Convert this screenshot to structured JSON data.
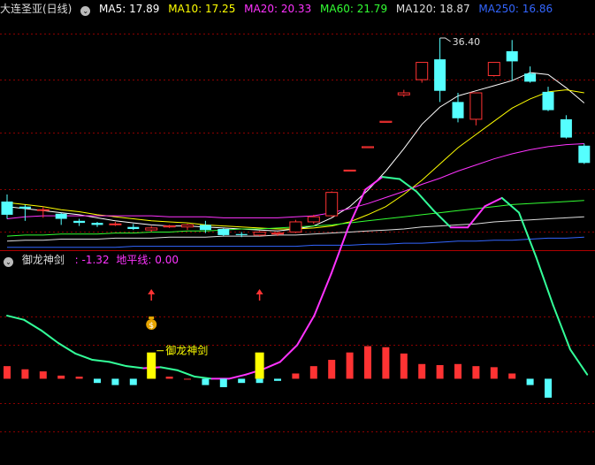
{
  "header": {
    "symbol": "大连圣亚(日线)",
    "ma": [
      {
        "label": "MA5: 17.89",
        "color": "#ffffff"
      },
      {
        "label": "MA10: 17.25",
        "color": "#ffff00"
      },
      {
        "label": "MA20: 20.33",
        "color": "#ff33ff"
      },
      {
        "label": "MA60: 21.79",
        "color": "#33ff33"
      },
      {
        "label": "MA120: 18.87",
        "color": "#dddddd"
      },
      {
        "label": "MA250: 16.86",
        "color": "#3366ff"
      }
    ],
    "icon": "chevron-down-icon"
  },
  "indicator_header": {
    "name": "御龙神剑",
    "value_label": ": -1.32",
    "baseline_label": "地平线: 0.00",
    "icon": "chevron-down-icon"
  },
  "annotations": {
    "max_price": "36.40",
    "signal_label": "御龙神剑",
    "money_icon": "money-bag-icon",
    "arrow_icon": "up-arrow-icon"
  },
  "colors": {
    "up": "#ff3333",
    "down": "#55ffff",
    "signal_bar": "#ffff00",
    "osc_down": "#33ff99",
    "osc_up": "#ff33ff",
    "grid": "#8b0000"
  },
  "chart_data": [
    {
      "type": "candlestick",
      "title": "大连圣亚(日线)",
      "candles": [
        {
          "o": 20.3,
          "h": 21.0,
          "l": 18.6,
          "c": 19.0
        },
        {
          "o": 19.8,
          "h": 20.0,
          "l": 18.4,
          "c": 19.6
        },
        {
          "o": 19.5,
          "h": 19.8,
          "l": 18.7,
          "c": 19.5
        },
        {
          "o": 19.1,
          "h": 19.2,
          "l": 18.0,
          "c": 18.6
        },
        {
          "o": 18.4,
          "h": 18.6,
          "l": 17.9,
          "c": 18.2
        },
        {
          "o": 18.2,
          "h": 18.3,
          "l": 17.8,
          "c": 18.0
        },
        {
          "o": 18.1,
          "h": 18.3,
          "l": 17.9,
          "c": 18.1
        },
        {
          "o": 17.8,
          "h": 18.1,
          "l": 17.5,
          "c": 17.6
        },
        {
          "o": 17.5,
          "h": 17.9,
          "l": 17.3,
          "c": 17.7
        },
        {
          "o": 17.8,
          "h": 18.0,
          "l": 17.7,
          "c": 17.9
        },
        {
          "o": 17.8,
          "h": 18.1,
          "l": 17.5,
          "c": 18.0
        },
        {
          "o": 18.0,
          "h": 18.4,
          "l": 17.2,
          "c": 17.5
        },
        {
          "o": 17.6,
          "h": 17.7,
          "l": 16.9,
          "c": 17.0
        },
        {
          "o": 17.1,
          "h": 17.3,
          "l": 16.8,
          "c": 17.0
        },
        {
          "o": 17.0,
          "h": 17.4,
          "l": 16.9,
          "c": 17.3
        },
        {
          "o": 17.1,
          "h": 17.3,
          "l": 16.9,
          "c": 17.2
        },
        {
          "o": 17.3,
          "h": 18.5,
          "l": 17.2,
          "c": 18.3
        },
        {
          "o": 18.3,
          "h": 19.0,
          "l": 18.1,
          "c": 18.8
        },
        {
          "o": 18.9,
          "h": 21.3,
          "l": 18.8,
          "c": 21.2
        },
        {
          "o": 23.3,
          "h": 23.4,
          "l": 23.3,
          "c": 23.4
        },
        {
          "o": 25.6,
          "h": 25.7,
          "l": 25.6,
          "c": 25.7
        },
        {
          "o": 28.1,
          "h": 28.2,
          "l": 28.1,
          "c": 28.2
        },
        {
          "o": 30.8,
          "h": 31.3,
          "l": 30.6,
          "c": 31.0
        },
        {
          "o": 32.3,
          "h": 34.0,
          "l": 32.0,
          "c": 34.0
        },
        {
          "o": 34.3,
          "h": 36.4,
          "l": 30.1,
          "c": 31.2
        },
        {
          "o": 30.1,
          "h": 31.0,
          "l": 28.1,
          "c": 28.5
        },
        {
          "o": 28.4,
          "h": 31.0,
          "l": 27.8,
          "c": 31.0
        },
        {
          "o": 32.7,
          "h": 34.0,
          "l": 32.6,
          "c": 34.0
        },
        {
          "o": 35.1,
          "h": 36.2,
          "l": 32.2,
          "c": 34.1
        },
        {
          "o": 32.9,
          "h": 33.6,
          "l": 32.0,
          "c": 32.1
        },
        {
          "o": 31.1,
          "h": 31.6,
          "l": 29.2,
          "c": 29.3
        },
        {
          "o": 28.4,
          "h": 28.8,
          "l": 26.5,
          "c": 26.6
        },
        {
          "o": 25.8,
          "h": 26.0,
          "l": 24.0,
          "c": 24.1
        }
      ],
      "ma_lines": {
        "MA5": [
          19.8,
          19.6,
          19.4,
          19.2,
          19.0,
          18.7,
          18.4,
          18.2,
          18.0,
          17.9,
          17.9,
          17.8,
          17.7,
          17.6,
          17.5,
          17.4,
          17.6,
          17.9,
          18.7,
          19.8,
          21.4,
          23.3,
          25.5,
          27.9,
          29.6,
          30.7,
          31.2,
          31.7,
          32.2,
          33.0,
          32.8,
          31.5,
          30.0
        ],
        "MA10": [
          20.2,
          20.0,
          19.8,
          19.5,
          19.3,
          19.0,
          18.8,
          18.6,
          18.4,
          18.3,
          18.2,
          18.0,
          17.9,
          17.8,
          17.7,
          17.6,
          17.6,
          17.7,
          17.9,
          18.3,
          19.0,
          19.8,
          21.0,
          22.4,
          24.0,
          25.6,
          26.9,
          28.2,
          29.5,
          30.4,
          31.1,
          31.3,
          31.0
        ],
        "MA20": [
          18.6,
          18.8,
          18.9,
          18.9,
          18.9,
          18.9,
          18.9,
          18.9,
          18.9,
          18.8,
          18.8,
          18.8,
          18.7,
          18.7,
          18.7,
          18.7,
          18.8,
          18.9,
          19.2,
          19.6,
          20.1,
          20.7,
          21.3,
          22.0,
          22.6,
          23.3,
          23.9,
          24.5,
          25.0,
          25.4,
          25.7,
          25.9,
          26.0
        ],
        "MA60": [
          16.9,
          17.0,
          17.0,
          17.1,
          17.1,
          17.1,
          17.2,
          17.2,
          17.3,
          17.3,
          17.4,
          17.4,
          17.5,
          17.6,
          17.6,
          17.7,
          17.8,
          17.9,
          18.0,
          18.2,
          18.4,
          18.6,
          18.8,
          19.0,
          19.2,
          19.4,
          19.6,
          19.8,
          20.0,
          20.1,
          20.2,
          20.3,
          20.4
        ],
        "MA120": [
          16.4,
          16.5,
          16.5,
          16.6,
          16.6,
          16.6,
          16.7,
          16.7,
          16.7,
          16.8,
          16.8,
          16.8,
          16.9,
          16.9,
          16.9,
          17.0,
          17.0,
          17.1,
          17.2,
          17.3,
          17.4,
          17.5,
          17.6,
          17.8,
          17.9,
          18.0,
          18.1,
          18.3,
          18.4,
          18.5,
          18.6,
          18.7,
          18.8
        ],
        "MA250": [
          15.8,
          15.8,
          15.8,
          15.8,
          15.8,
          15.8,
          15.8,
          15.9,
          15.9,
          15.9,
          15.9,
          15.9,
          15.9,
          15.9,
          15.9,
          15.9,
          15.9,
          16.0,
          16.0,
          16.0,
          16.1,
          16.1,
          16.2,
          16.2,
          16.3,
          16.4,
          16.4,
          16.5,
          16.5,
          16.6,
          16.7,
          16.7,
          16.8
        ]
      },
      "ylim": [
        15.6,
        38.4
      ],
      "max_label": "36.40"
    },
    {
      "type": "oscillator",
      "title": "御龙神剑",
      "line": [
        3.0,
        2.8,
        2.3,
        1.7,
        1.2,
        0.9,
        0.8,
        0.6,
        0.5,
        0.55,
        0.4,
        0.1,
        0.0,
        0.0,
        0.2,
        0.45,
        0.8,
        1.6,
        3.0,
        5.0,
        7.2,
        9.0,
        9.6,
        9.5,
        8.9,
        8.0,
        7.2,
        7.2,
        8.2,
        8.6,
        7.9,
        5.8,
        3.5,
        1.4,
        0.2
      ],
      "bars": [
        0.6,
        0.45,
        0.35,
        0.15,
        0.1,
        -0.2,
        -0.3,
        -0.3,
        0.1,
        0.1,
        0.0,
        -0.3,
        -0.4,
        -0.2,
        -0.2,
        -0.1,
        0.25,
        0.6,
        0.9,
        1.25,
        1.55,
        1.5,
        1.2,
        0.7,
        0.65,
        0.7,
        0.6,
        0.55,
        0.25,
        -0.3,
        -0.9
      ],
      "signal_bars": [
        {
          "index": 8,
          "value": 1.25
        },
        {
          "index": 14,
          "value": 1.25
        }
      ],
      "ylim": [
        -3.85,
        5.4
      ],
      "baseline": 0.0
    }
  ]
}
